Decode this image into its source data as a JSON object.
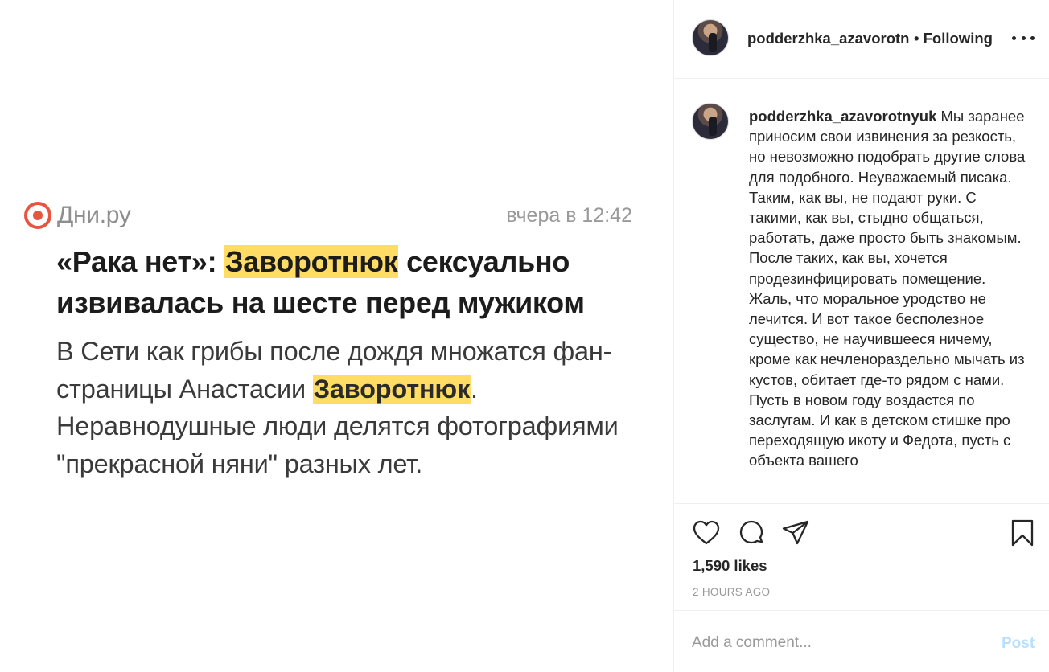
{
  "post_image": {
    "source_name": "Дни.ру",
    "source_time": "вчера в 12:42",
    "headline": {
      "part1": "«Рака нет»: ",
      "highlight": "Заворотнюк",
      "part2": " сексуально извивалась на шесте перед мужиком"
    },
    "snippet": {
      "part1": "В Сети как грибы после дождя множатся фан-страницы Анастасии ",
      "highlight": "Заворотнюк",
      "part2": ". Неравнодушные люди делятся фотографиями \"прекрасной няни\" разных лет."
    }
  },
  "header": {
    "username": "podderzhka_azavorotn",
    "follow_status": "• Following"
  },
  "caption": {
    "username": "podderzhka_azavorotnyuk",
    "text": " Мы заранее приносим свои извинения за резкость, но невозможно подобрать другие слова для подобного. Неуважаемый писака. Таким, как вы, не подают руки. С такими, как вы, стыдно общаться, работать, даже просто быть знакомым. После таких, как вы, хочется продезинфицировать помещение. Жаль, что моральное уродство не лечится. И вот такое бесполезное существо, не научившееся ничему, кроме как нечленораздельно мычать из кустов, обитает где-то рядом с нами. Пусть в новом году воздастся по заслугам. И как в детском стишке про переходящую икоту и Федота, пусть с объекта вашего"
  },
  "actions": {
    "icons": [
      "heart-icon",
      "comment-icon",
      "share-icon",
      "bookmark-icon"
    ],
    "likes": "1,590 likes",
    "timestamp": "2 HOURS AGO"
  },
  "comment_box": {
    "placeholder": "Add a comment...",
    "post_label": "Post"
  },
  "colors": {
    "highlight": "#ffdc63",
    "source_logo": "#e7553f",
    "post_button_disabled": "#b9dffc",
    "divider": "#efefef"
  }
}
